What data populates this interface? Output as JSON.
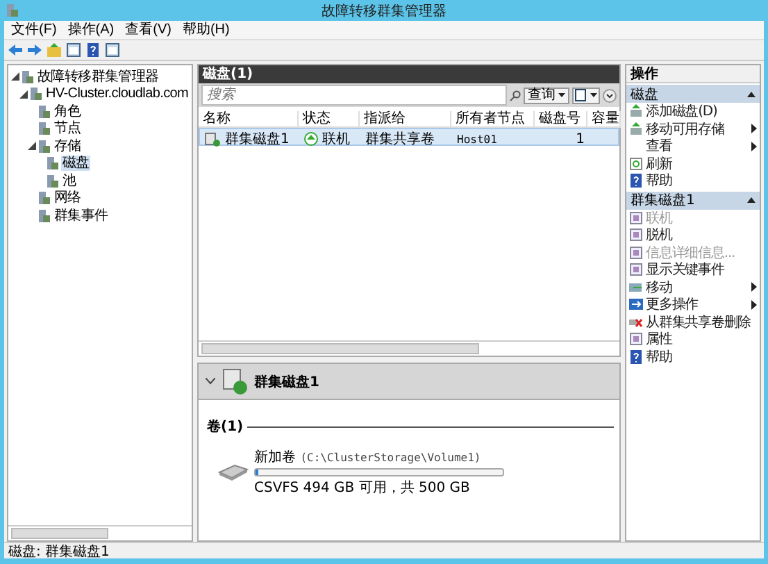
{
  "window": {
    "title": "故障转移群集管理器"
  },
  "menu": [
    "文件(F)",
    "操作(A)",
    "查看(V)",
    "帮助(H)"
  ],
  "tree": [
    {
      "label": "故障转移群集管理器",
      "selected": false,
      "expanded": true,
      "children": [
        {
          "label": "HV-Cluster.cloudlab.com",
          "selected": false,
          "expanded": true,
          "children": [
            {
              "label": "角色",
              "selected": false
            },
            {
              "label": "节点",
              "selected": false
            },
            {
              "label": "存储",
              "selected": false,
              "expanded": true,
              "children": [
                {
                  "label": "磁盘",
                  "selected": true
                },
                {
                  "label": "池",
                  "selected": false
                }
              ]
            },
            {
              "label": "网络",
              "selected": false
            },
            {
              "label": "群集事件",
              "selected": false
            }
          ]
        }
      ]
    }
  ],
  "list": {
    "title": "磁盘(1)",
    "search_placeholder": "搜索",
    "query_button": "查询",
    "columns": [
      "名称",
      "状态",
      "指派给",
      "所有者节点",
      "磁盘号",
      "容量"
    ],
    "rows": [
      {
        "cells": [
          "群集磁盘1",
          "联机",
          "群集共享卷",
          "Host01",
          "1"
        ],
        "selected": true
      }
    ]
  },
  "details": {
    "title": "群集磁盘1",
    "section": "卷(1)",
    "volume": {
      "name": "新加卷",
      "path": "(C:\\ClusterStorage\\Volume1)",
      "level": 0.012,
      "summary": "CSVFS 494 GB 可用，共 500 GB"
    }
  },
  "actions": {
    "title": "操作",
    "groups": [
      {
        "title": "磁盘",
        "items": [
          {
            "label": "添加磁盘(D)",
            "kind": "add",
            "disabled": false,
            "submenu": false
          },
          {
            "label": "移动可用存储",
            "kind": "add",
            "disabled": false,
            "submenu": true
          },
          {
            "label": "查看",
            "kind": "none",
            "disabled": false,
            "submenu": true
          },
          {
            "label": "刷新",
            "kind": "refresh",
            "disabled": false,
            "submenu": false
          },
          {
            "label": "帮助",
            "kind": "help",
            "disabled": false,
            "submenu": false
          }
        ]
      },
      {
        "title": "群集磁盘1",
        "items": [
          {
            "label": "联机",
            "kind": "page",
            "disabled": true,
            "submenu": false
          },
          {
            "label": "脱机",
            "kind": "page",
            "disabled": false,
            "submenu": false
          },
          {
            "label": "信息详细信息...",
            "kind": "page",
            "disabled": true,
            "submenu": false
          },
          {
            "label": "显示关键事件",
            "kind": "page",
            "disabled": false,
            "submenu": false
          },
          {
            "label": "移动",
            "kind": "move",
            "disabled": false,
            "submenu": true
          },
          {
            "label": "更多操作",
            "kind": "more",
            "disabled": false,
            "submenu": true
          },
          {
            "label": "从群集共享卷删除",
            "kind": "remove",
            "disabled": false,
            "submenu": false
          },
          {
            "label": "属性",
            "kind": "page",
            "disabled": false,
            "submenu": false
          },
          {
            "label": "帮助",
            "kind": "help",
            "disabled": false,
            "submenu": false
          }
        ]
      }
    ]
  },
  "status_bar": "磁盘:  群集磁盘1"
}
